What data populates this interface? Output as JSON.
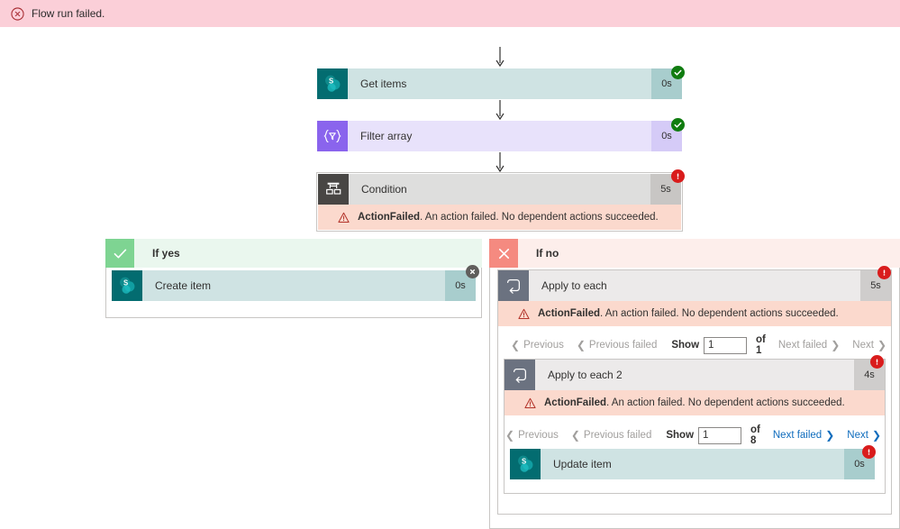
{
  "banner": {
    "icon": "error-circle-icon",
    "text": "Flow run failed."
  },
  "error_message": {
    "bold": "ActionFailed",
    "rest": ". An action failed. No dependent actions succeeded.",
    "icon": "warning-triangle-icon"
  },
  "flow": {
    "get_items": {
      "title": "Get items",
      "duration": "0s",
      "icon": "sharepoint-icon",
      "status": "succeeded"
    },
    "filter_array": {
      "title": "Filter array",
      "duration": "0s",
      "icon": "filter-array-icon",
      "status": "succeeded"
    },
    "condition": {
      "title": "Condition",
      "duration": "5s",
      "icon": "condition-icon",
      "status": "failed"
    },
    "if_yes": {
      "label": "If yes",
      "icon": "checkmark-icon"
    },
    "create_item": {
      "title": "Create item",
      "duration": "0s",
      "icon": "sharepoint-icon",
      "status": "skipped"
    },
    "if_no": {
      "label": "If no",
      "icon": "close-x-icon"
    },
    "apply_to_each": {
      "title": "Apply to each",
      "duration": "5s",
      "icon": "loop-icon",
      "status": "failed"
    },
    "apply_to_each_2": {
      "title": "Apply to each 2",
      "duration": "4s",
      "icon": "loop-icon",
      "status": "failed"
    },
    "update_item": {
      "title": "Update item",
      "duration": "0s",
      "icon": "sharepoint-icon",
      "status": "failed"
    }
  },
  "pager_1": {
    "previous": "Previous",
    "previous_failed": "Previous failed",
    "show": "Show",
    "value": "1",
    "of": "of 1",
    "next_failed": "Next failed",
    "next": "Next"
  },
  "pager_2": {
    "previous": "Previous",
    "previous_failed": "Previous failed",
    "show": "Show",
    "value": "1",
    "of": "of 8",
    "next_failed": "Next failed",
    "next": "Next"
  },
  "colors": {
    "banner_bg": "#fbcfd8",
    "error_red": "#d91c1c",
    "success_green": "#107c10",
    "skip_gray": "#605e5c",
    "link_blue": "#0f6cbd",
    "sharepoint_teal": "#036c70",
    "filter_purple": "#8a64ed",
    "error_strip_bg": "#fbd9cd"
  }
}
